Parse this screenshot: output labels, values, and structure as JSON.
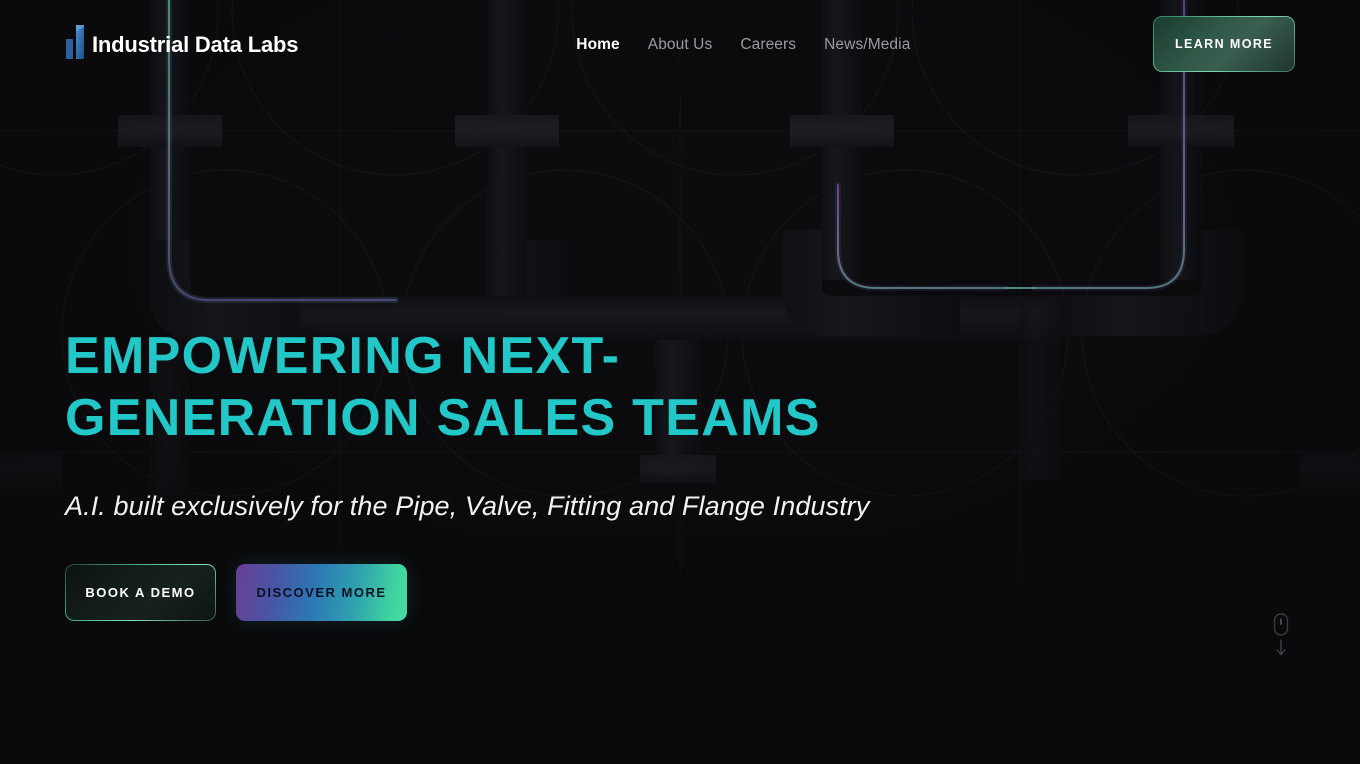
{
  "site": {
    "background_color": "#0a0a0c",
    "accent_teal": "#22c8c8",
    "accent_purple": "#6a3f94",
    "accent_green": "#63c79a"
  },
  "header": {
    "brand": {
      "mark_icon": "bar-chart-logo-icon",
      "name": "Industrial Data Labs"
    },
    "nav": [
      {
        "label": "Home",
        "active": true
      },
      {
        "label": "About Us",
        "active": false
      },
      {
        "label": "Careers",
        "active": false
      },
      {
        "label": "News/Media",
        "active": false
      }
    ],
    "learn_more_label": "LEARN MORE"
  },
  "hero": {
    "title": "EMPOWERING NEXT-GENERATION SALES TEAMS",
    "subtitle": "A.I. built exclusively for the Pipe, Valve, Fitting and Flange Industry",
    "buttons": {
      "primary_label": "BOOK A DEMO",
      "secondary_label": "DISCOVER MORE"
    }
  },
  "scroll_indicator": {
    "icon": "mouse-scroll-down-icon"
  }
}
